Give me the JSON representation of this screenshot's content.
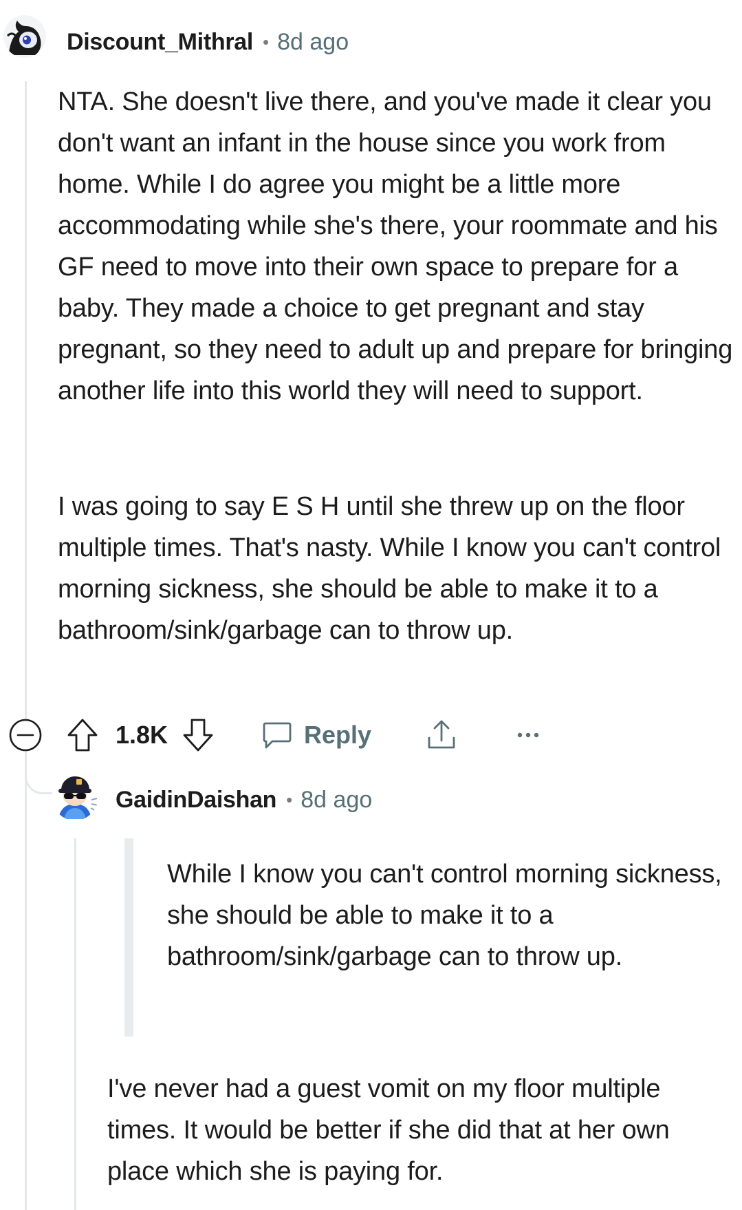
{
  "comments": [
    {
      "username": "Discount_Mithral",
      "separator": "•",
      "age": "8d ago",
      "paragraphs": [
        "NTA. She doesn't live there, and you've made it clear you don't want an infant in the house since you work from home. While I do agree you might be a little more accommodating while she's there, your roommate and his GF need to move into their own space to prepare for a baby. They made a choice to get pregnant and stay pregnant, so they need to adult up and prepare for bringing another life into this world they will need to support.",
        "I was going to say E S H until she threw up on the floor multiple times. That's nasty. While I know you can't control morning sickness, she should be able to make it to a bathroom/sink/garbage can to throw up."
      ],
      "actions": {
        "vote_count": "1.8K",
        "reply_label": "Reply",
        "collapse_icon": "minus-circle-icon",
        "upvote_icon": "arrow-up-outline-icon",
        "downvote_icon": "arrow-down-outline-icon",
        "reply_icon": "speech-bubble-icon",
        "share_icon": "share-upload-icon",
        "more_icon": "ellipsis-icon"
      }
    },
    {
      "username": "GaidinDaishan",
      "separator": "•",
      "age": "8d ago",
      "quote": "While I know you can't control morning sickness, she should be able to make it to a bathroom/sink/garbage can to throw up.",
      "paragraphs": [
        "I've never had a guest vomit on my floor multiple times. It would be better if she did that at her own place which she is paying for."
      ]
    }
  ],
  "colors": {
    "text": "#1c1c1c",
    "meta": "#576f76",
    "thread_line": "#e5e8ea",
    "quote_bar": "#e8ebed"
  }
}
